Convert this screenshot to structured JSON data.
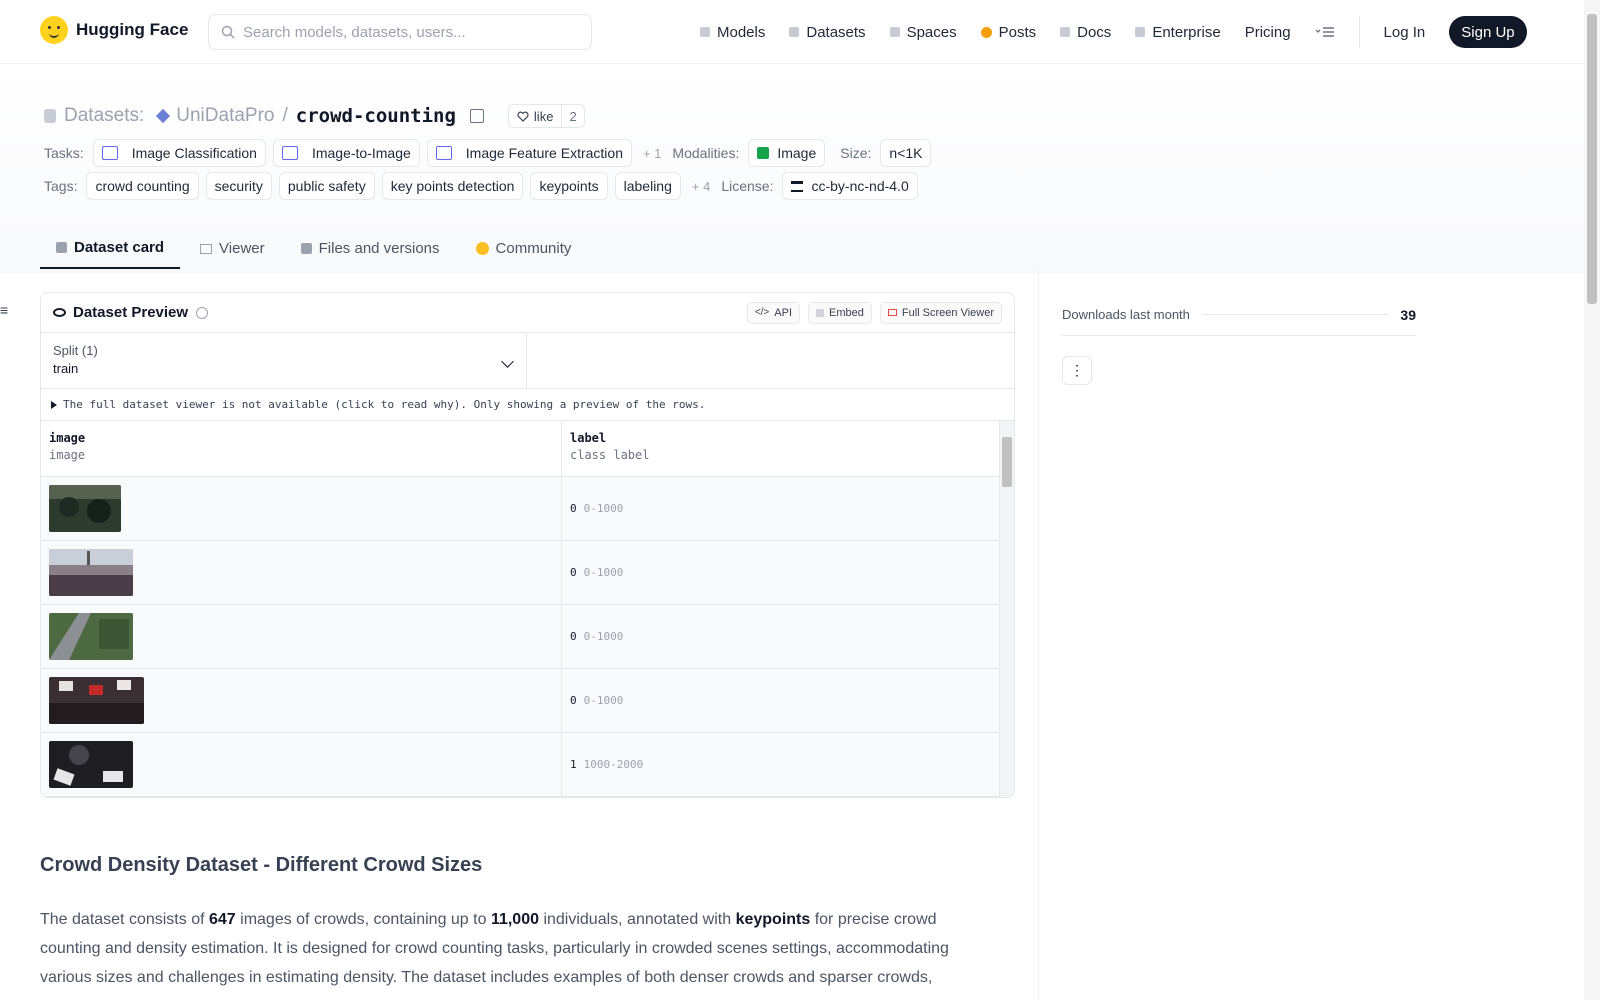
{
  "header": {
    "brand": "Hugging Face",
    "search_placeholder": "Search models, datasets, users...",
    "nav": [
      "Models",
      "Datasets",
      "Spaces",
      "Posts",
      "Docs",
      "Enterprise"
    ],
    "pricing": "Pricing",
    "login": "Log In",
    "signup": "Sign Up"
  },
  "repo": {
    "section": "Datasets:",
    "org": "UniDataPro",
    "sep": "/",
    "name": "crowd-counting",
    "like_label": "like",
    "like_count": "2"
  },
  "meta": {
    "tasks_label": "Tasks:",
    "tasks": [
      "Image Classification",
      "Image-to-Image",
      "Image Feature Extraction"
    ],
    "tasks_more": "+ 1",
    "modalities_label": "Modalities:",
    "modality": "Image",
    "size_label": "Size:",
    "size": "n<1K",
    "tags_label": "Tags:",
    "tags": [
      "crowd counting",
      "security",
      "public safety",
      "key points detection",
      "keypoints",
      "labeling"
    ],
    "tags_more": "+ 4",
    "license_label": "License:",
    "license": "cc-by-nc-nd-4.0"
  },
  "tabs": [
    "Dataset card",
    "Viewer",
    "Files and versions",
    "Community"
  ],
  "preview": {
    "title": "Dataset Preview",
    "buttons": [
      "API",
      "Embed",
      "Full Screen Viewer"
    ],
    "split_label": "Split (1)",
    "split_value": "train",
    "notice": "The full dataset viewer is not available (click to read why). Only showing a preview of the rows.",
    "columns": [
      {
        "name": "image",
        "type": "image"
      },
      {
        "name": "label",
        "type": "class label"
      }
    ],
    "rows": [
      {
        "num": "0",
        "label": "0-1000"
      },
      {
        "num": "0",
        "label": "0-1000"
      },
      {
        "num": "0",
        "label": "0-1000"
      },
      {
        "num": "0",
        "label": "0-1000"
      },
      {
        "num": "1",
        "label": "1000-2000"
      }
    ]
  },
  "sidebar": {
    "downloads_label": "Downloads last month",
    "downloads_value": "39",
    "menu_icon": "⋮"
  },
  "readme": {
    "heading": "Crowd Density Dataset - Different Crowd Sizes",
    "p_a": "The dataset consists of ",
    "p_b": "647",
    "p_c": " images of crowds, containing up to ",
    "p_d": "11,000",
    "p_e": " individuals, annotated with ",
    "p_f": "keypoints",
    "p_g": " for precise crowd counting and density estimation. It is designed for crowd counting tasks, particularly in crowded scenes settings, accommodating various sizes and challenges in estimating density. The dataset includes examples of both denser crowds and sparser crowds,"
  },
  "colors": {
    "brand_yellow": "#ffd21e",
    "signup_bg": "#111827",
    "task_icon": "#6366f1",
    "modality_icon": "#16a34a"
  }
}
